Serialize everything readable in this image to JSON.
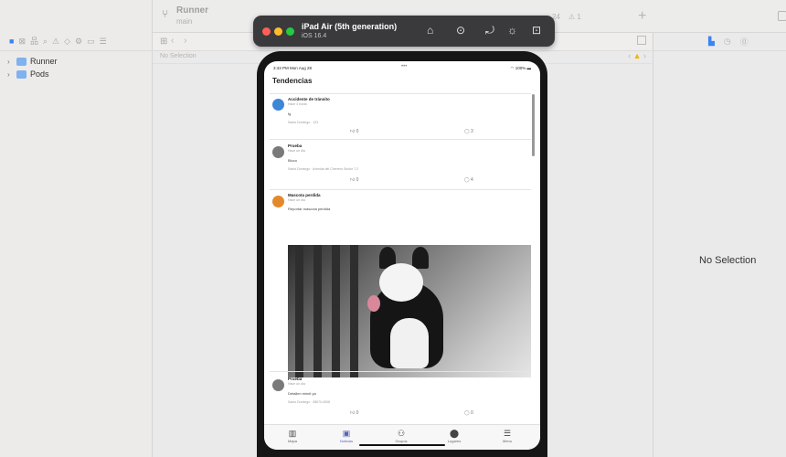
{
  "xcode": {
    "scheme": {
      "name": "Runner",
      "branch": "main"
    },
    "status": {
      "device_badge": "24",
      "warning_count": "⚠ 1"
    },
    "navigator": {
      "items": [
        {
          "label": "Runner"
        },
        {
          "label": "Pods"
        }
      ]
    },
    "editor": {
      "no_selection": "No Selection"
    },
    "inspector": {
      "no_selection": "No Selection"
    }
  },
  "simulator": {
    "device_name": "iPad Air (5th generation)",
    "os_version": "iOS 16.4"
  },
  "app": {
    "status_time": "3:43 PM  Mon Aug 28",
    "status_battery": "100%",
    "title": "Tendencias",
    "posts": [
      {
        "title": "Accidente de tránsito",
        "time": "Hace 3 horas",
        "body": "fg",
        "location": "Santo Domingo · 123",
        "likes": "0",
        "comments": "3",
        "avatar_color": "#3d87d6"
      },
      {
        "title": "Prueba",
        "time": "Hace un día",
        "body": "Bloco",
        "location": "Santo Domingo · Avenida del Cherrero Sector 7.2",
        "likes": "0",
        "comments": "4",
        "avatar_color": "#7a7a7a"
      },
      {
        "title": "Mascota perdida",
        "time": "Hace un día",
        "body": "Reportar mascota perdida",
        "location": "Santo Domingo · P0451004",
        "likes": "1",
        "comments": "0",
        "avatar_color": "#e4892b"
      },
      {
        "title": "Prueba",
        "time": "Hace un día",
        "body": "Detallen mimit ya",
        "location": "Santo Domingo · 08570-0508",
        "likes": "0",
        "comments": "0",
        "avatar_color": "#7a7a7a"
      }
    ],
    "tabs": [
      {
        "label": "Mapa",
        "icon": "map-icon"
      },
      {
        "label": "Noticias",
        "icon": "news-icon"
      },
      {
        "label": "Grupos",
        "icon": "groups-icon"
      },
      {
        "label": "Lugares",
        "icon": "places-icon"
      },
      {
        "label": "Menu",
        "icon": "menu-icon"
      }
    ],
    "active_tab": "Noticias"
  },
  "colors": {
    "accent": "#3b83f7",
    "active_tab": "#5966b0"
  }
}
